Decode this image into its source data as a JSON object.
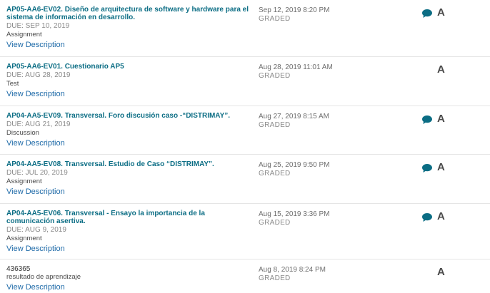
{
  "items": [
    {
      "title": "AP05-AA6-EV02. Diseño de arquitectura de software y hardware para el sistema de información en desarrollo.",
      "due": "DUE: SEP 10, 2019",
      "type": "Assignment",
      "view_label": "View Description",
      "date": "Sep 12, 2019 8:20 PM",
      "status": "GRADED",
      "grade": "A",
      "has_comment": true
    },
    {
      "title": "AP05-AA6-EV01. Cuestionario AP5",
      "due": "DUE: AUG 28, 2019",
      "type": "Test",
      "view_label": "View Description",
      "date": "Aug 28, 2019 11:01 AM",
      "status": "GRADED",
      "grade": "A",
      "has_comment": false
    },
    {
      "title": "AP04-AA5-EV09. Transversal. Foro discusión caso -“DISTRIMAY”.",
      "due": "DUE: AUG 21, 2019",
      "type": "Discussion",
      "view_label": "View Description",
      "date": "Aug 27, 2019 8:15 AM",
      "status": "GRADED",
      "grade": "A",
      "has_comment": true
    },
    {
      "title": "AP04-AA5-EV08. Transversal. Estudio de Caso “DISTRIMAY”.",
      "due": "DUE: JUL 20, 2019",
      "type": "Assignment",
      "view_label": "View Description",
      "date": "Aug 25, 2019 9:50 PM",
      "status": "GRADED",
      "grade": "A",
      "has_comment": true
    },
    {
      "title": "AP04-AA5-EV06. Transversal - Ensayo la importancia de la comunicación asertiva.",
      "due": "DUE: AUG 9, 2019",
      "type": "Assignment",
      "view_label": "View Description",
      "date": "Aug 15, 2019 3:36 PM",
      "status": "GRADED",
      "grade": "A",
      "has_comment": true
    },
    {
      "title": "436365",
      "due": "",
      "type": "resultado de aprendizaje",
      "view_label": "View Description",
      "date": "Aug 8, 2019 8:24 PM",
      "status": "GRADED",
      "grade": "A",
      "has_comment": false
    }
  ],
  "colors": {
    "title_link": "#0b6d84",
    "view_link": "#1e6aa8",
    "comment_icon": "#0b6d84",
    "grade": "#4a4a4a"
  },
  "icons": {
    "comment": "speech-bubble-icon"
  }
}
